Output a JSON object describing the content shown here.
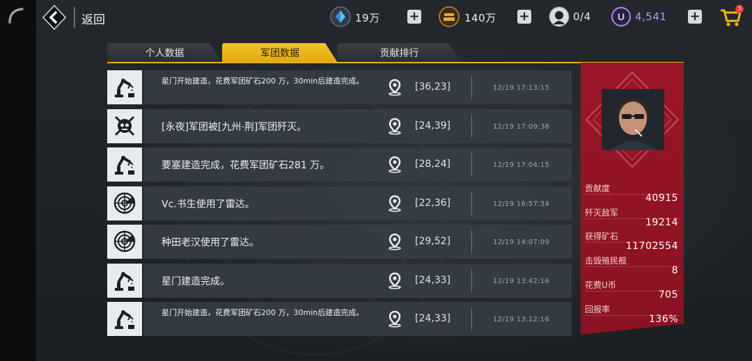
{
  "topbar": {
    "back_label": "返回",
    "crystal_value": "19万",
    "ore_value": "140万",
    "troops_value": "0/4",
    "u_value": "4,541",
    "cart_badge": "3"
  },
  "tabs": [
    {
      "label": "个人数据",
      "active": false
    },
    {
      "label": "军团数据",
      "active": true
    },
    {
      "label": "贡献排行",
      "active": false
    }
  ],
  "log": [
    {
      "icon": "robot-arm-icon",
      "message": "星门开始建造，花费军团矿石200 万，30min后建造完成。",
      "coords": "[36,23]",
      "time": "12/19 17:13:15",
      "two_line": true
    },
    {
      "icon": "crossed-swords-skull-icon",
      "message": "[永夜]军团被[九州·荆]军团歼灭。",
      "coords": "[24,39]",
      "time": "12/19 17:09:38",
      "two_line": false
    },
    {
      "icon": "robot-arm-icon",
      "message": "要塞建造完成，花费军团矿石281 万。",
      "coords": "[28,24]",
      "time": "12/19 17:04:15",
      "two_line": false
    },
    {
      "icon": "radar-icon",
      "message": "Vc.书生使用了雷达。",
      "coords": "[22,36]",
      "time": "12/19 16:57:34",
      "two_line": false
    },
    {
      "icon": "radar-icon",
      "message": "种田老汉使用了雷达。",
      "coords": "[29,52]",
      "time": "12/19 14:07:09",
      "two_line": false
    },
    {
      "icon": "robot-arm-icon",
      "message": "星门建造完成。",
      "coords": "[24,33]",
      "time": "12/19 13:42:16",
      "two_line": false
    },
    {
      "icon": "robot-arm-icon",
      "message": "星门开始建造，花费军团矿石200 万，30min后建造完成。",
      "coords": "[24,33]",
      "time": "12/19 13:12:16",
      "two_line": true
    }
  ],
  "stats": [
    {
      "label": "贡献度",
      "value": "40915"
    },
    {
      "label": "歼灭敌军",
      "value": "19214"
    },
    {
      "label": "获得矿石",
      "value": "11702554"
    },
    {
      "label": "击毁殖民舰",
      "value": "8"
    },
    {
      "label": "花费U币",
      "value": "705"
    },
    {
      "label": "回报率",
      "value": "136%"
    }
  ],
  "colors": {
    "accent": "#e6b117",
    "panel": "#8f1424",
    "u_currency": "#b69be9"
  }
}
